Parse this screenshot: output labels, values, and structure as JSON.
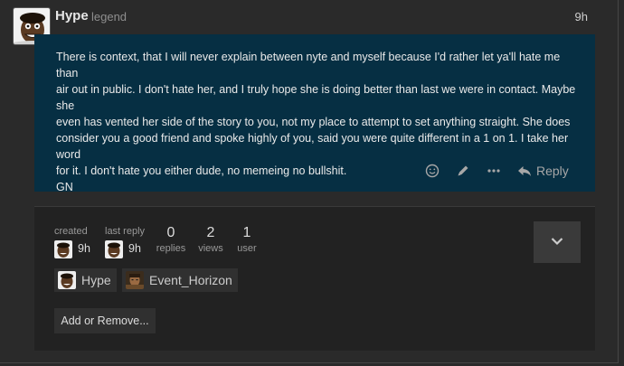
{
  "post": {
    "username": "Hype",
    "user_title": "legend",
    "time": "9h",
    "body_lines": [
      "There is context, that I will never explain between nyte and myself because I'd rather let ya'll hate me than",
      "air out in public. I don't hate her, and I truly hope she is doing better than last we were in contact. Maybe she",
      "even has vented her side of the story to you, not my place to attempt to set anything straight. She does",
      "consider you a good friend and spoke highly of you, said you were quite different in a 1 on 1. I take her word",
      "for it. I don't hate you either dude, no memeing no bullshit.",
      "GN"
    ],
    "actions": {
      "like_icon": "smile-icon",
      "edit_icon": "pencil-icon",
      "more_icon": "ellipsis-icon",
      "reply_icon": "reply-arrow-icon",
      "reply_label": "Reply"
    }
  },
  "topic_map": {
    "created_label": "created",
    "created_value": "9h",
    "last_reply_label": "last reply",
    "last_reply_value": "9h",
    "replies_count": "0",
    "replies_label": "replies",
    "views_count": "2",
    "views_label": "views",
    "users_count": "1",
    "users_label": "user",
    "expand_icon": "chevron-down-icon",
    "participants": [
      {
        "name": "Hype"
      },
      {
        "name": "Event_Horizon"
      }
    ],
    "add_remove_label": "Add or Remove..."
  },
  "colors": {
    "background": "#2a2a2a",
    "post_background": "#062f43",
    "topic_map_background": "#222222",
    "button_background": "#303030"
  }
}
